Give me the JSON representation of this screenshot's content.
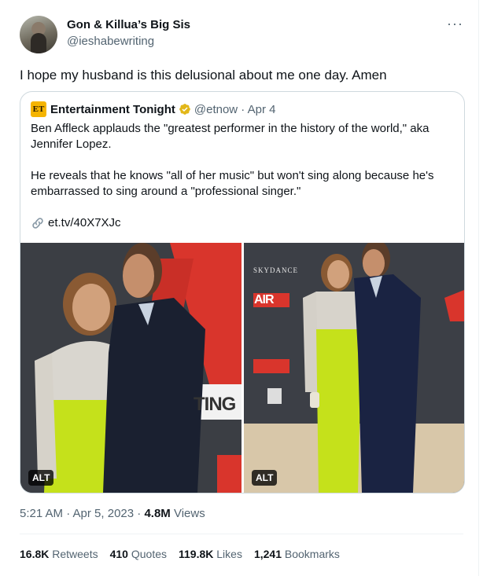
{
  "tweet": {
    "display_name": "Gon & Killua’s Big Sis",
    "handle": "@ieshabewriting",
    "text": "I hope my husband is this delusional about me one day. Amen",
    "more_icon": "more-dots-icon"
  },
  "quote": {
    "logo": "ET",
    "name": "Entertainment Tonight",
    "handle_date": "@etnow · Apr 4",
    "paragraph1": "Ben Affleck applauds the \"greatest performer in the history of the world,\" aka Jennifer Lopez.",
    "paragraph2": "He reveals that he knows \"all of her music\" but won't sing along because he's embarrassed to sing around a \"professional singer.\"",
    "link": "et.tv/40X7XJc",
    "photos": [
      {
        "alt_badge": "ALT",
        "backdrop_text": "TING"
      },
      {
        "alt_badge": "ALT",
        "backdrop_brand": "SKYDANCE",
        "backdrop_text": "AIR"
      }
    ]
  },
  "meta": {
    "time": "5:21 AM · Apr 5, 2023 · ",
    "views_count": "4.8M",
    "views_label": " Views"
  },
  "stats": [
    {
      "count": "16.8K",
      "label": " Retweets"
    },
    {
      "count": "410",
      "label": " Quotes"
    },
    {
      "count": "119.8K",
      "label": " Likes"
    },
    {
      "count": "1,241",
      "label": " Bookmarks"
    }
  ],
  "colors": {
    "brand": "#1d9bf0",
    "et_gold": "#f5b400",
    "dress_lime": "#c5e11b",
    "air_red": "#e4342a"
  }
}
